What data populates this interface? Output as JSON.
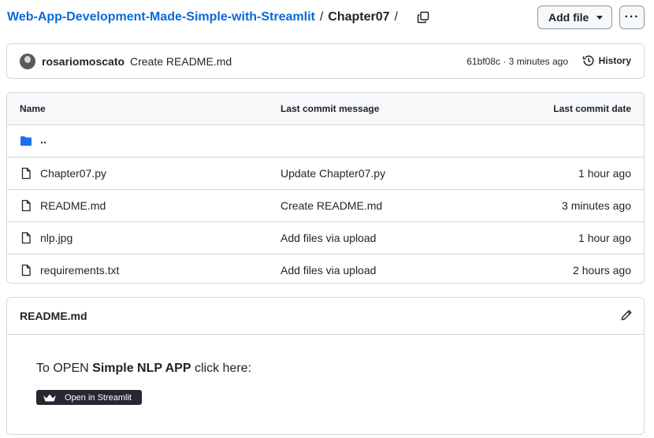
{
  "breadcrumb": {
    "repo": "Web-App-Development-Made-Simple-with-Streamlit",
    "separator": "/",
    "directory": "Chapter07",
    "trailing": "/"
  },
  "toolbar": {
    "add_file_label": "Add file",
    "more_label": "···"
  },
  "commit": {
    "author": "rosariomoscato",
    "message": "Create README.md",
    "meta": "61bf08c · 3 minutes ago",
    "history_label": "History"
  },
  "files": {
    "headers": {
      "name": "Name",
      "message": "Last commit message",
      "date": "Last commit date"
    },
    "parent_label": "..",
    "rows": [
      {
        "name": "Chapter07.py",
        "message": "Update Chapter07.py",
        "date": "1 hour ago"
      },
      {
        "name": "README.md",
        "message": "Create README.md",
        "date": "3 minutes ago"
      },
      {
        "name": "nlp.jpg",
        "message": "Add files via upload",
        "date": "1 hour ago"
      },
      {
        "name": "requirements.txt",
        "message": "Add files via upload",
        "date": "2 hours ago"
      }
    ]
  },
  "readme": {
    "title": "README.md",
    "text_prefix": "To OPEN ",
    "text_bold": "Simple NLP APP",
    "text_suffix": " click here:",
    "badge_label": "Open in Streamlit"
  },
  "colors": {
    "link": "#0969da",
    "border": "#d0d7de",
    "folder": "#1f6feb",
    "badge_bg": "#262730"
  }
}
